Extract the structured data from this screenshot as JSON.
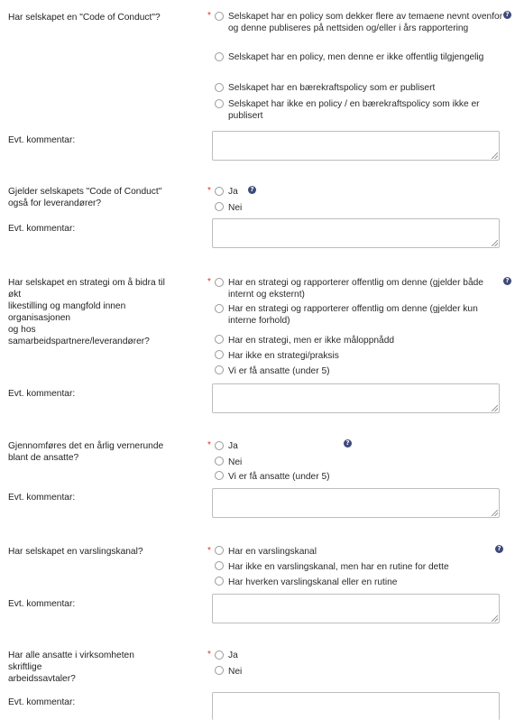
{
  "sections": [
    {
      "question": "Har selskapet en \"Code of Conduct\"?",
      "options": [
        "Selskapet har en policy som dekker flere av temaene nevnt ovenfor og denne publiseres på nettsiden og/eller i års rapportering",
        "Selskapet har en policy, men denne er ikke offentlig tilgjengelig",
        "Selskapet har en bærekraftspolicy som er publisert",
        "Selskapet har ikke en policy / en bærekraftspolicy som ikke er publisert"
      ],
      "comment_label": "Evt. kommentar:"
    },
    {
      "question": "Gjelder selskapets \"Code of Conduct\"\nogså for leverandører?",
      "options": [
        "Ja",
        "Nei"
      ],
      "comment_label": "Evt. kommentar:"
    },
    {
      "question": "Har selskapet en strategi om å bidra til\nøkt\nlikestilling og mangfold innen\norganisasjonen\nog hos\nsamarbeidspartnere/leverandører?",
      "options": [
        "Har en strategi og rapporterer offentlig om denne (gjelder både internt og eksternt)",
        "Har en strategi og rapporterer offentlig om denne (gjelder kun interne forhold)",
        "Har en strategi, men er ikke måloppnådd",
        "Har ikke en strategi/praksis",
        "Vi er få ansatte (under 5)"
      ],
      "comment_label": "Evt. kommentar:"
    },
    {
      "question": "Gjennomføres det en årlig vernerunde\nblant de ansatte?",
      "options": [
        "Ja",
        "Nei",
        "Vi er få ansatte (under 5)"
      ],
      "comment_label": "Evt. kommentar:"
    },
    {
      "question": "Har selskapet en varslingskanal?",
      "options": [
        "Har en varslingskanal",
        "Har ikke en varslingskanal, men har en rutine for dette",
        "Har hverken varslingskanal eller en rutine"
      ],
      "comment_label": "Evt. kommentar:"
    },
    {
      "question": "Har alle ansatte i virksomheten\nskriftlige\narbeidssavtaler?",
      "options": [
        "Ja",
        "Nei"
      ],
      "comment_label": "Evt. kommentar:"
    }
  ],
  "required_marker": "*",
  "help_glyph": "?",
  "icons": {
    "help": "question-circle-icon",
    "required": "asterisk-icon"
  },
  "colors": {
    "required": "#e03030",
    "help_icon": "#3d4a7a",
    "textarea_border": "#bdbdbd"
  }
}
